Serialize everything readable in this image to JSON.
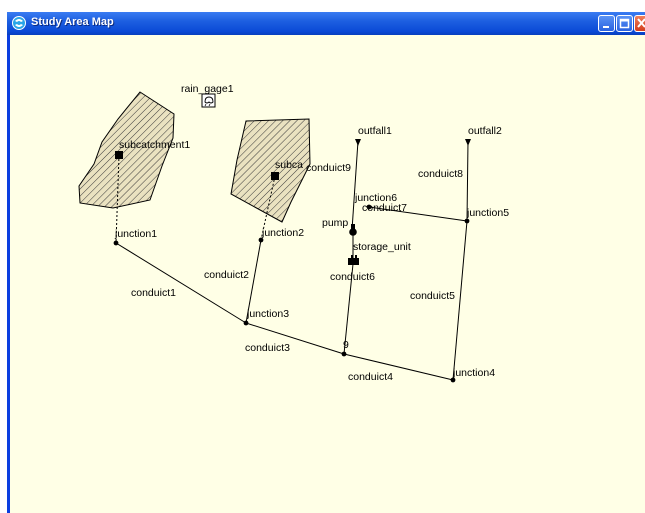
{
  "window": {
    "title": "Study Area Map",
    "background": "#ffffe6",
    "titlebar_color": "#0a49d6",
    "icons": {
      "app": "swmm-app-icon",
      "minimize": "minimize-icon",
      "maximize": "maximize-icon",
      "close": "close-icon"
    }
  },
  "map": {
    "rain_gage": "rain_gage1",
    "subcatchments": [
      "subcatchment1",
      "subca"
    ],
    "junctions": [
      "junction1",
      "junction2",
      "junction3",
      "9",
      "junction4",
      "junction5",
      "junction6"
    ],
    "outfalls": [
      "outfall1",
      "outfall2"
    ],
    "storage": "storage_unit",
    "pump": "pump",
    "conduits": [
      "conduict1",
      "conduict2",
      "conduict3",
      "conduict4",
      "conduict5",
      "conduict6",
      "conduict7",
      "conduict8",
      "conduict9"
    ]
  }
}
